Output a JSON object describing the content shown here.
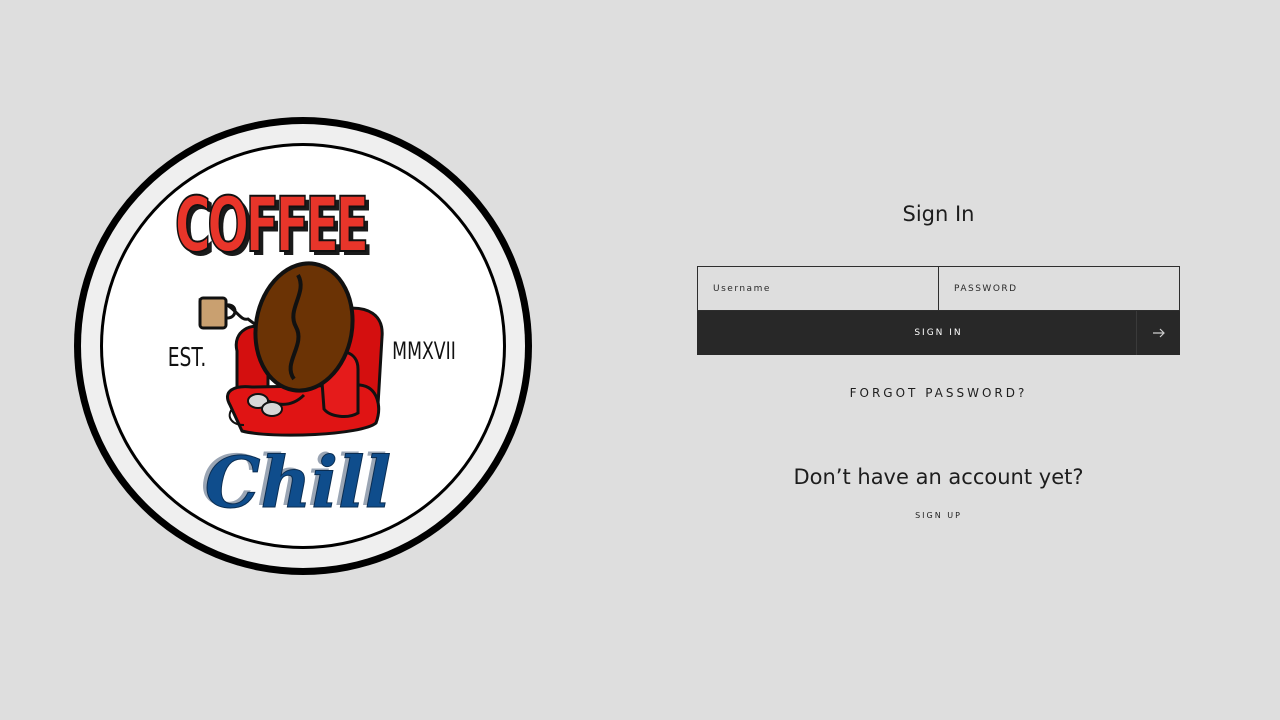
{
  "logo": {
    "top_text": "COFFEE",
    "bottom_text": "Chill",
    "est_left": "EST.",
    "est_right": "MMXVII",
    "colors": {
      "red": "#e8352a",
      "chair_red": "#d40f0f",
      "bean_brown": "#6b3305",
      "chill_blue": "#0f4d8c",
      "cup_tan": "#c9a070"
    }
  },
  "auth": {
    "title": "Sign In",
    "username_placeholder": "Username",
    "password_placeholder": "PASSWORD",
    "signin_label": "SIGN IN",
    "arrow_icon": "arrow-right-icon",
    "forgot_label": "FORGOT PASSWORD?",
    "no_account_text": "Don’t have an account yet?",
    "signup_label": "SIGN UP"
  },
  "colors": {
    "background": "#dedede",
    "button_bg": "#282828",
    "text": "#1d1d1d"
  }
}
